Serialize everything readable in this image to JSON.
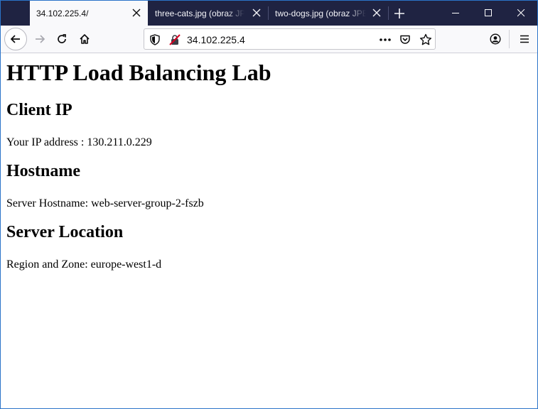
{
  "browser": {
    "tabs": [
      {
        "title": "34.102.225.4/",
        "active": true
      },
      {
        "title": "three-cats.jpg (obraz JPEG",
        "active": false
      },
      {
        "title": "two-dogs.jpg (obraz JPEG",
        "active": false
      }
    ],
    "url": "34.102.225.4",
    "icons": {
      "new_tab": "plus-icon",
      "back": "arrow-left-icon",
      "forward": "arrow-right-icon",
      "reload": "reload-icon",
      "home": "home-icon",
      "tracking": "shield-icon",
      "connection": "insecure-lock-icon",
      "page_actions": "ellipsis-icon",
      "pocket": "pocket-icon",
      "bookmark": "star-icon",
      "account": "account-icon",
      "menu": "hamburger-icon"
    },
    "colors": {
      "tabstrip": "#1f2342",
      "active_tab": "#f9f9fb",
      "frame_border": "#2b74c9",
      "insecure_red": "#d70022"
    }
  },
  "page": {
    "title": "HTTP Load Balancing Lab",
    "sections": [
      {
        "heading": "Client IP",
        "text": "Your IP address : 130.211.0.229"
      },
      {
        "heading": "Hostname",
        "text": "Server Hostname: web-server-group-2-fszb"
      },
      {
        "heading": "Server Location",
        "text": "Region and Zone: europe-west1-d"
      }
    ]
  }
}
